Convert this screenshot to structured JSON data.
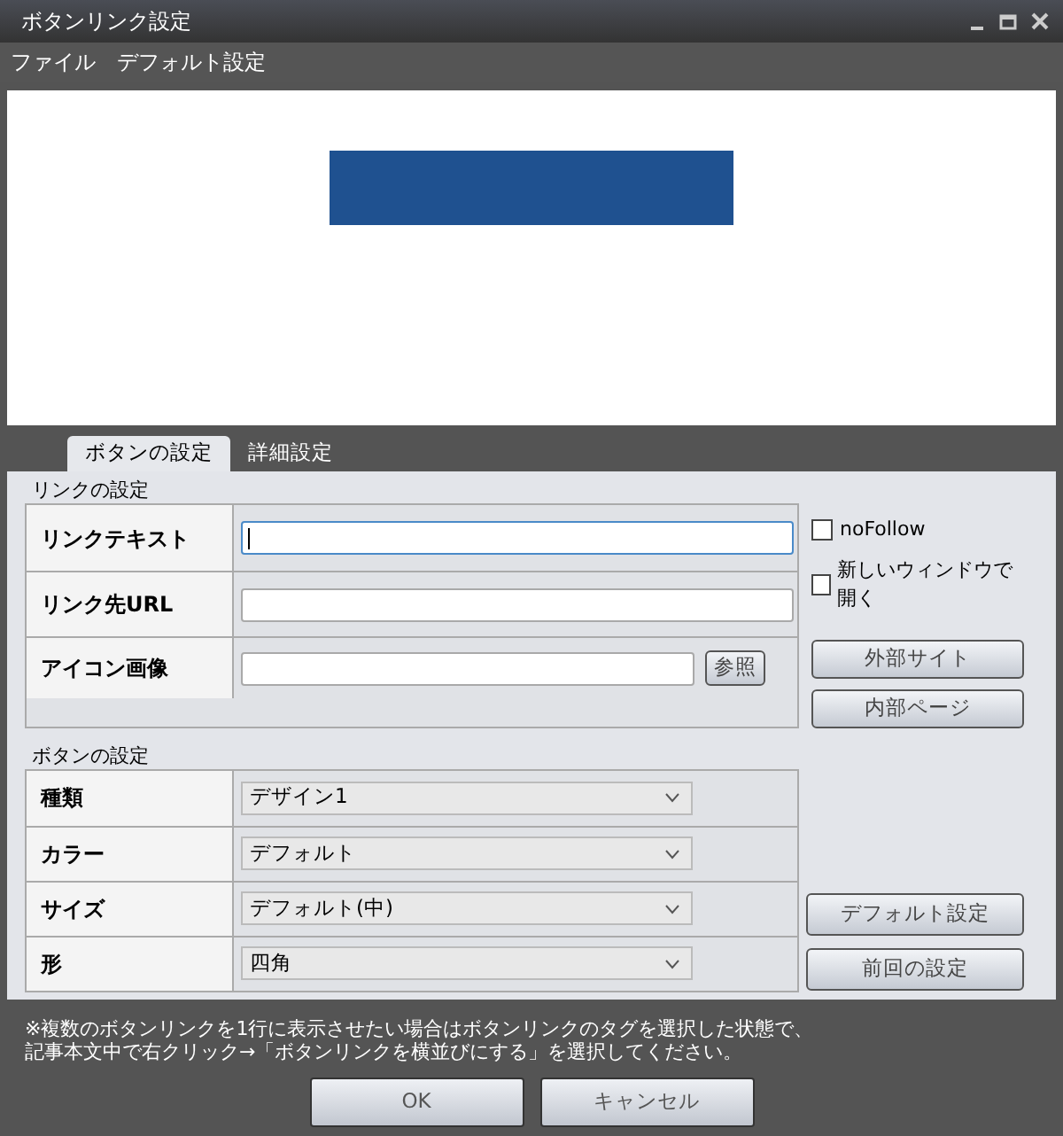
{
  "window": {
    "title": "ボタンリンク設定"
  },
  "menu": [
    "ファイル",
    "デフォルト設定"
  ],
  "tabs": [
    {
      "label": "ボタンの設定",
      "selected": true
    },
    {
      "label": "詳細設定",
      "selected": false
    }
  ],
  "link_settings": {
    "title": "リンクの設定",
    "rows": [
      {
        "label": "リンクテキスト",
        "focused": true
      },
      {
        "label": "リンク先URL",
        "focused": false
      },
      {
        "label": "アイコン画像",
        "focused": false,
        "button": "参照"
      }
    ],
    "checkboxes": [
      {
        "label": "noFollow",
        "checked": false
      },
      {
        "label": "新しいウィンドウで開く",
        "checked": false
      }
    ],
    "buttons": [
      "外部サイト",
      "内部ページ"
    ]
  },
  "button_settings": {
    "title": "ボタンの設定",
    "rows": [
      {
        "label": "種類",
        "value": "デザイン1"
      },
      {
        "label": "カラー",
        "value": "デフォルト"
      },
      {
        "label": "サイズ",
        "value": "デフォルト(中)"
      },
      {
        "label": "形",
        "value": "四角"
      }
    ],
    "buttons": [
      "デフォルト設定",
      "前回の設定"
    ]
  },
  "note": [
    "※複数のボタンリンクを1行に表示させたい場合はボタンリンクのタグを選択した状態で、",
    "記事本文中で右クリック→「ボタンリンクを横並びにする」を選択してください。"
  ],
  "footer_buttons": [
    "OK",
    "キャンセル"
  ]
}
